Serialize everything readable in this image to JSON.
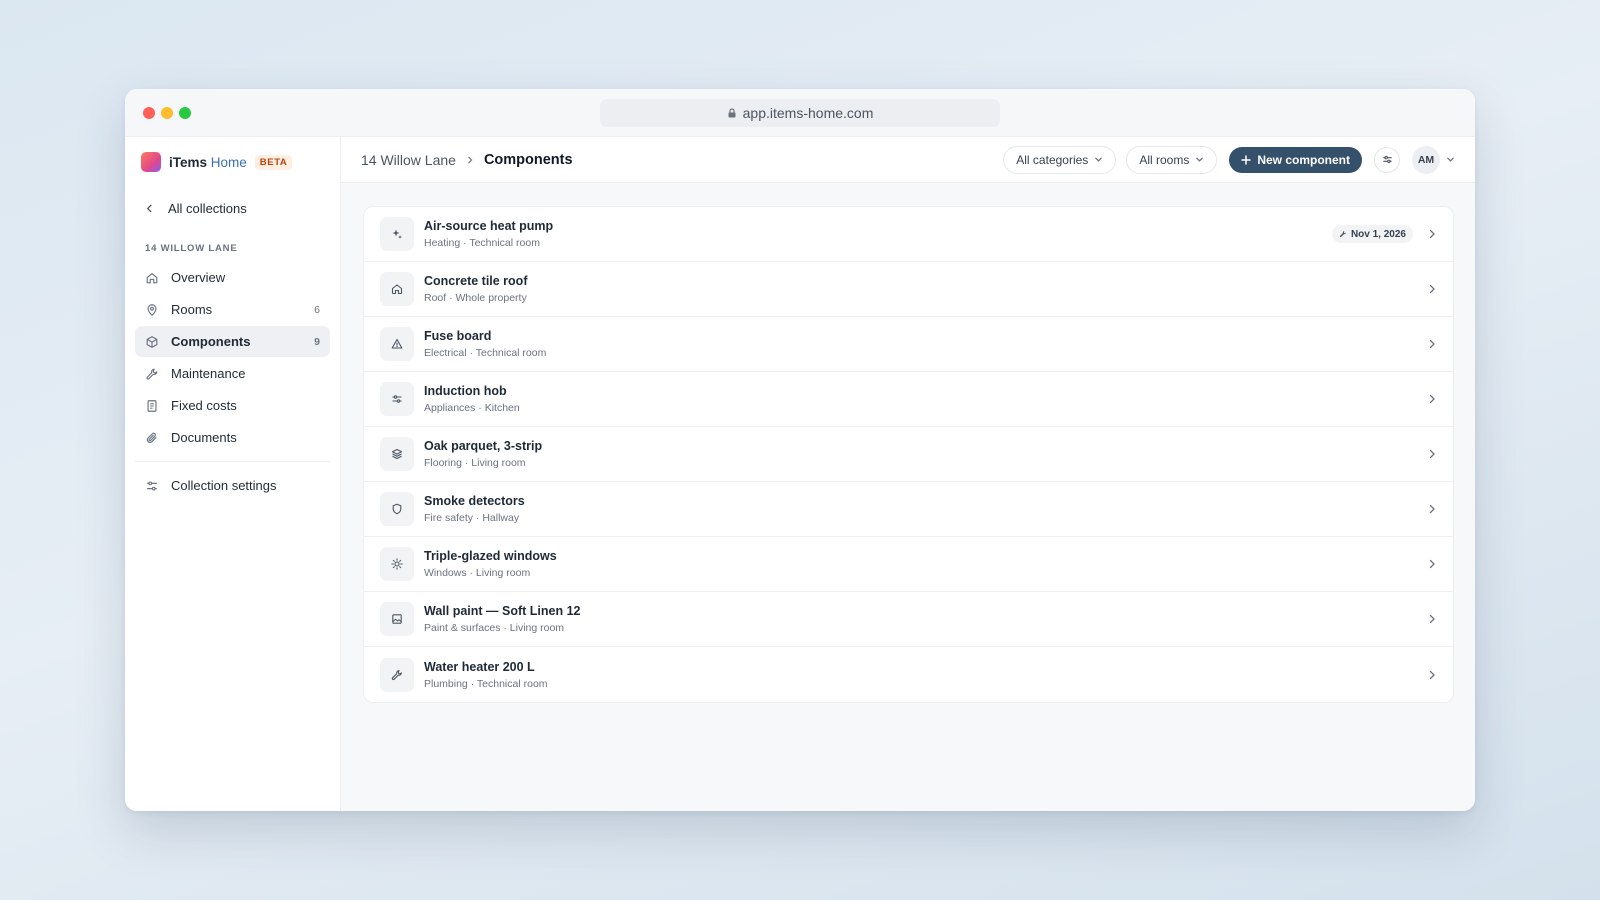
{
  "window": {
    "url": "app.items-home.com"
  },
  "sidebar": {
    "brand": {
      "name": "iTems",
      "accent": "Home",
      "badge": "BETA"
    },
    "back_label": "All collections",
    "section_label": "14 WILLOW LANE",
    "items": [
      {
        "label": "Overview",
        "icon": "home-icon",
        "count": ""
      },
      {
        "label": "Rooms",
        "icon": "pin-icon",
        "count": "6"
      },
      {
        "label": "Components",
        "icon": "cube-icon",
        "count": "9",
        "active": true
      },
      {
        "label": "Maintenance",
        "icon": "wrench-icon",
        "count": ""
      },
      {
        "label": "Fixed costs",
        "icon": "receipt-icon",
        "count": ""
      },
      {
        "label": "Documents",
        "icon": "paperclip-icon",
        "count": ""
      }
    ],
    "settings_label": "Collection settings"
  },
  "header": {
    "breadcrumb_parent": "14 Willow Lane",
    "breadcrumb_current": "Components",
    "filter_categories": "All categories",
    "filter_rooms": "All rooms",
    "new_button": "New component",
    "avatar_initials": "AM"
  },
  "components": [
    {
      "title": "Air-source heat pump",
      "subtitle": "Heating · Technical room",
      "icon": "sparkle-icon",
      "badge": "Nov 1, 2026"
    },
    {
      "title": "Concrete tile roof",
      "subtitle": "Roof · Whole property",
      "icon": "home-icon"
    },
    {
      "title": "Fuse board",
      "subtitle": "Electrical · Technical room",
      "icon": "warning-icon"
    },
    {
      "title": "Induction hob",
      "subtitle": "Appliances · Kitchen",
      "icon": "sliders-icon"
    },
    {
      "title": "Oak parquet, 3-strip",
      "subtitle": "Flooring · Living room",
      "icon": "layers-icon"
    },
    {
      "title": "Smoke detectors",
      "subtitle": "Fire safety · Hallway",
      "icon": "shield-icon"
    },
    {
      "title": "Triple-glazed windows",
      "subtitle": "Windows · Living room",
      "icon": "sun-icon"
    },
    {
      "title": "Wall paint — Soft Linen 12",
      "subtitle": "Paint & surfaces · Living room",
      "icon": "image-icon"
    },
    {
      "title": "Water heater 200 L",
      "subtitle": "Plumbing · Technical room",
      "icon": "wrench-icon"
    }
  ],
  "colors": {
    "primary_button": "#34506b",
    "traffic_red": "#ff5f57",
    "traffic_yellow": "#febc2e",
    "traffic_green": "#28c840",
    "brand_accent": "#3b6fb6",
    "beta_badge": "#c2410c"
  }
}
